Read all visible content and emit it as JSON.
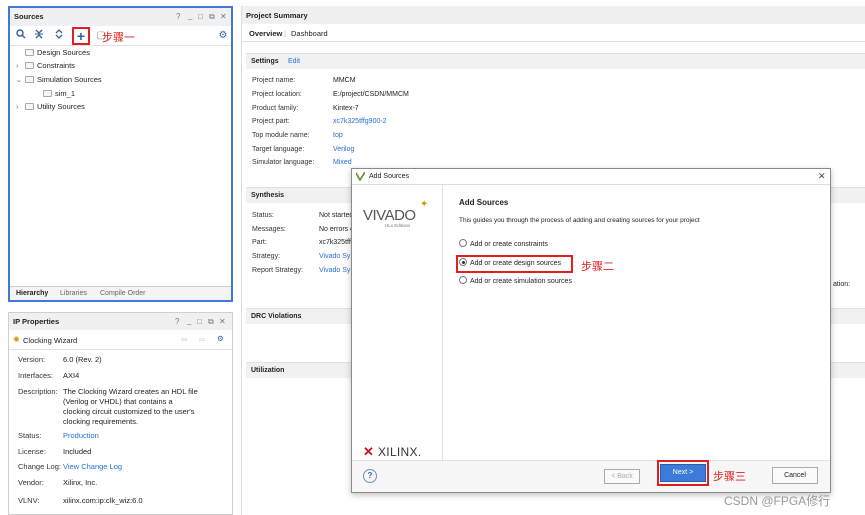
{
  "sources": {
    "title": "Sources",
    "header_controls": [
      "?",
      "_",
      "□",
      "⧉",
      "✕"
    ],
    "tree": [
      {
        "label": "Design Sources",
        "expand": ""
      },
      {
        "label": "Constraints",
        "expand": "›"
      },
      {
        "label": "Simulation Sources",
        "expand": "⌄"
      },
      {
        "label": "sim_1",
        "expand": ""
      },
      {
        "label": "Utility Sources",
        "expand": "›"
      }
    ],
    "tabs": [
      "Hierarchy",
      "Libraries",
      "Compile Order"
    ],
    "annotation": "步骤一"
  },
  "ip_properties": {
    "title": "IP Properties",
    "header_controls": [
      "?",
      "_",
      "□",
      "⧉",
      "✕"
    ],
    "ip_name": "Clocking Wizard",
    "props": [
      {
        "label": "Version:",
        "value": "6.0 (Rev. 2)"
      },
      {
        "label": "Interfaces:",
        "value": "AXI4"
      },
      {
        "label": "Description:",
        "value": "The Clocking Wizard creates an HDL file (Verilog or VHDL) that contains a clocking circuit customized to the user's clocking requirements."
      },
      {
        "label": "Status:",
        "value": "Production"
      },
      {
        "label": "License:",
        "value": "Included"
      },
      {
        "label": "Change Log:",
        "value": "View Change Log"
      },
      {
        "label": "Vendor:",
        "value": "Xilinx, Inc."
      },
      {
        "label": "VLNV:",
        "value": "xilinx.com:ip:clk_wiz:6.0"
      }
    ]
  },
  "summary": {
    "title": "Project Summary",
    "tabs": [
      "Overview",
      "Dashboard"
    ],
    "settings_label": "Settings",
    "edit_label": "Edit",
    "settings": [
      {
        "label": "Project name:",
        "value": "MMCM"
      },
      {
        "label": "Project location:",
        "value": "E:/project/CSDN/MMCM"
      },
      {
        "label": "Product family:",
        "value": "Kintex-7"
      },
      {
        "label": "Project part:",
        "value": "xc7k325tffg900-2"
      },
      {
        "label": "Top module name:",
        "value": "top"
      },
      {
        "label": "Target language:",
        "value": "Verilog"
      },
      {
        "label": "Simulator language:",
        "value": "Mixed"
      }
    ],
    "synthesis_label": "Synthesis",
    "synthesis": [
      {
        "label": "Status:",
        "value": "Not started"
      },
      {
        "label": "Messages:",
        "value": "No errors o"
      },
      {
        "label": "Part:",
        "value": "xc7k325tff"
      },
      {
        "label": "Strategy:",
        "value": "Vivado Sy"
      },
      {
        "label": "Report Strategy:",
        "value": "Vivado Sy"
      }
    ],
    "drc_label": "DRC Violations",
    "utilization_label": "Utilization",
    "right_cut_text": "ation:"
  },
  "dialog": {
    "title": "Add Sources",
    "vivado_logo": "VIVADO",
    "vivado_sub": "HLx Editions",
    "xilinx_logo": "XILINX.",
    "heading": "Add Sources",
    "description": "This guides you through the process of adding and creating sources for your project",
    "options": [
      {
        "label": "Add or create constraints",
        "selected": false
      },
      {
        "label": "Add or create design sources",
        "selected": true
      },
      {
        "label": "Add or create simulation sources",
        "selected": false
      }
    ],
    "annotation_step2": "步骤二",
    "annotation_step3": "步骤三",
    "back_label": "< Back",
    "next_label": "Next >",
    "cancel_label": "Cancel",
    "help_label": "?"
  },
  "watermark": "CSDN @FPGA修行"
}
